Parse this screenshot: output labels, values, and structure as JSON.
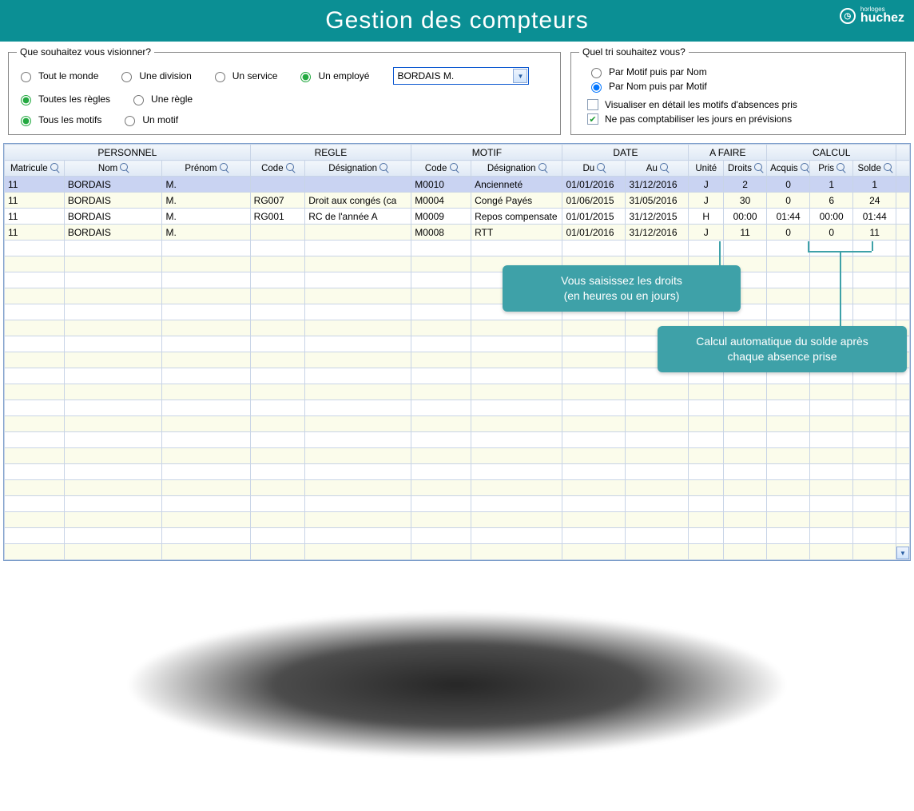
{
  "header": {
    "title": "Gestion des compteurs",
    "brand_top": "horloges",
    "brand": "huchez"
  },
  "view_filter": {
    "legend": "Que souhaitez vous visionner?",
    "row1": {
      "everyone": "Tout le monde",
      "division": "Une division",
      "service": "Un service",
      "employee": "Un employé",
      "employee_selected": "BORDAIS M."
    },
    "row2": {
      "all_rules": "Toutes les règles",
      "one_rule": "Une règle"
    },
    "row3": {
      "all_motifs": "Tous les motifs",
      "one_motif": "Un motif"
    }
  },
  "sort_filter": {
    "legend": "Quel tri souhaitez vous?",
    "by_motif": "Par Motif puis par Nom",
    "by_name": "Par Nom puis par Motif"
  },
  "options": {
    "detail": "Visualiser en détail les motifs d'absences pris",
    "ignore_forecast": "Ne pas comptabiliser les jours en prévisions"
  },
  "grid": {
    "groups": {
      "personnel": "PERSONNEL",
      "regle": "REGLE",
      "motif": "MOTIF",
      "date": "DATE",
      "afaire": "A FAIRE",
      "calcul": "CALCUL"
    },
    "cols": {
      "matricule": "Matricule",
      "nom": "Nom",
      "prenom": "Prénom",
      "code_r": "Code",
      "desig_r": "Désignation",
      "code_m": "Code",
      "desig_m": "Désignation",
      "du": "Du",
      "au": "Au",
      "unite": "Unité",
      "droits": "Droits",
      "acquis": "Acquis",
      "pris": "Pris",
      "solde": "Solde"
    },
    "rows": [
      {
        "mat": "11",
        "nom": "BORDAIS",
        "pre": "M.",
        "rc": "",
        "rd": "",
        "mc": "M0010",
        "md": "Ancienneté",
        "du": "01/01/2016",
        "au": "31/12/2016",
        "u": "J",
        "dr": "2",
        "ac": "0",
        "pr": "1",
        "so": "1"
      },
      {
        "mat": "11",
        "nom": "BORDAIS",
        "pre": "M.",
        "rc": "RG007",
        "rd": "Droit aux congés (ca",
        "mc": "M0004",
        "md": "Congé Payés",
        "du": "01/06/2015",
        "au": "31/05/2016",
        "u": "J",
        "dr": "30",
        "ac": "0",
        "pr": "6",
        "so": "24"
      },
      {
        "mat": "11",
        "nom": "BORDAIS",
        "pre": "M.",
        "rc": "RG001",
        "rd": "RC de l'année A",
        "mc": "M0009",
        "md": "Repos compensate",
        "du": "01/01/2015",
        "au": "31/12/2015",
        "u": "H",
        "dr": "00:00",
        "ac": "01:44",
        "pr": "00:00",
        "so": "01:44"
      },
      {
        "mat": "11",
        "nom": "BORDAIS",
        "pre": "M.",
        "rc": "",
        "rd": "",
        "mc": "M0008",
        "md": "RTT",
        "du": "01/01/2016",
        "au": "31/12/2016",
        "u": "J",
        "dr": "11",
        "ac": "0",
        "pr": "0",
        "so": "11"
      }
    ]
  },
  "callouts": {
    "droits_l1": "Vous saisissez les droits",
    "droits_l2": "(en heures ou en jours)",
    "solde_l1": "Calcul automatique du solde après",
    "solde_l2": "chaque absence prise"
  }
}
